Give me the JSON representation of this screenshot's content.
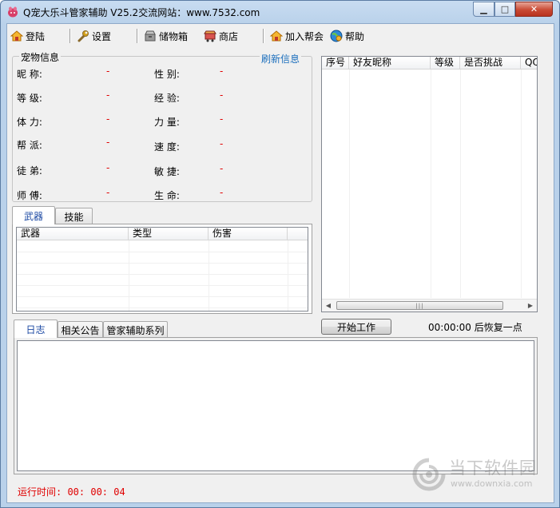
{
  "window": {
    "title": "Q宠大乐斗管家辅助 V25.2交流网站：www.7532.com"
  },
  "toolbar": {
    "items": [
      {
        "label": "登陆",
        "icon": "login-house-icon"
      },
      {
        "label": "设置",
        "icon": "wrench-icon"
      },
      {
        "label": "储物箱",
        "icon": "storage-box-icon"
      },
      {
        "label": "商店",
        "icon": "shop-cart-icon"
      },
      {
        "label": "加入帮会",
        "icon": "join-guild-house-icon"
      },
      {
        "label": "帮助",
        "icon": "help-globe-icon"
      }
    ]
  },
  "pet_info": {
    "title": "宠物信息",
    "refresh_label": "刷新信息",
    "fields_left": [
      {
        "label": "昵  称:",
        "value": "-"
      },
      {
        "label": "等  级:",
        "value": "-"
      },
      {
        "label": "体  力:",
        "value": "-"
      },
      {
        "label": "帮  派:",
        "value": "-"
      },
      {
        "label": "徒  弟:",
        "value": "-"
      },
      {
        "label": "师  傅:",
        "value": "-"
      }
    ],
    "fields_right": [
      {
        "label": "性  别:",
        "value": "-"
      },
      {
        "label": "经  验:",
        "value": "-"
      },
      {
        "label": "力  量:",
        "value": "-"
      },
      {
        "label": "速  度:",
        "value": "-"
      },
      {
        "label": "敏  捷:",
        "value": "-"
      },
      {
        "label": "生  命:",
        "value": "-"
      }
    ]
  },
  "equip_tabs": {
    "tabs": [
      "武器",
      "技能"
    ],
    "active": "武器",
    "columns": [
      "武器",
      "类型",
      "伤害"
    ]
  },
  "friends_table": {
    "columns": [
      "序号",
      "好友昵称",
      "等级",
      "是否挑战",
      "QQ"
    ]
  },
  "log_tabs": {
    "tabs": [
      "日志",
      "相关公告",
      "管家辅助系列"
    ],
    "active": "日志"
  },
  "controls": {
    "start_label": "开始工作",
    "recover_text": "00:00:00 后恢复一点"
  },
  "status": {
    "runtime": "运行时间: 00: 00: 04"
  },
  "watermark": {
    "title": "当下软件园",
    "url": "www.downxia.com"
  },
  "colors": {
    "accent_blue": "#1c6fbd",
    "value_red": "#e00000"
  }
}
